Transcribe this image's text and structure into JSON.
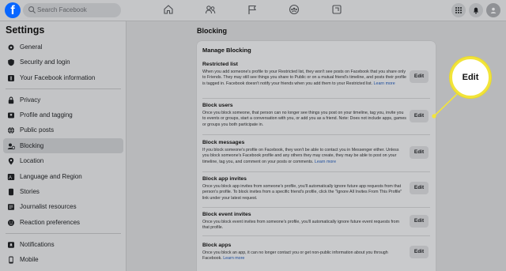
{
  "topbar": {
    "logo_letter": "f",
    "search_placeholder": "Search Facebook",
    "nav_icons": [
      "home-icon",
      "friends-icon",
      "flag-icon",
      "groups-icon",
      "gaming-icon"
    ],
    "right_icons": [
      "grid-menu-icon",
      "notifications-bell-icon",
      "account-avatar-icon"
    ]
  },
  "sidebar": {
    "title": "Settings",
    "items": [
      {
        "label": "General",
        "icon": "gear-icon"
      },
      {
        "label": "Security and login",
        "icon": "shield-icon"
      },
      {
        "label": "Your Facebook information",
        "icon": "facebook-info-icon"
      },
      {
        "label": "Privacy",
        "icon": "lock-icon"
      },
      {
        "label": "Profile and tagging",
        "icon": "tag-icon"
      },
      {
        "label": "Public posts",
        "icon": "globe-icon"
      },
      {
        "label": "Blocking",
        "icon": "blocking-icon"
      },
      {
        "label": "Location",
        "icon": "location-pin-icon"
      },
      {
        "label": "Language and Region",
        "icon": "language-icon"
      },
      {
        "label": "Stories",
        "icon": "stories-icon"
      },
      {
        "label": "Journalist resources",
        "icon": "journalist-icon"
      },
      {
        "label": "Reaction preferences",
        "icon": "reaction-icon"
      },
      {
        "label": "Notifications",
        "icon": "bell-icon"
      },
      {
        "label": "Mobile",
        "icon": "mobile-icon"
      }
    ],
    "active_item": "Blocking"
  },
  "main": {
    "title": "Blocking",
    "panel_title": "Manage Blocking",
    "sections": [
      {
        "title": "Restricted list",
        "description": "When you add someone's profile to your Restricted list, they won't see posts on Facebook that you share only to Friends. They may still see things you share to Public or on a mutual friend's timeline, and posts their profile is tagged in. Facebook doesn't notify your friends when you add them to your Restricted list.",
        "link": "Learn more",
        "button": "Edit"
      },
      {
        "title": "Block users",
        "description": "Once you block someone, that person can no longer see things you post on your timeline, tag you, invite you to events or groups, start a conversation with you, or add you as a friend. Note: Does not include apps, games or groups you both participate in.",
        "link": "",
        "button": "Edit"
      },
      {
        "title": "Block messages",
        "description": "If you block someone's profile on Facebook, they won't be able to contact you in Messenger either. Unless you block someone's Facebook profile and any others they may create, they may be able to post on your timeline, tag you, and comment on your posts or comments.",
        "link": "Learn more",
        "button": "Edit"
      },
      {
        "title": "Block app invites",
        "description": "Once you block app invites from someone's profile, you'll automatically ignore future app requests from that person's profile. To block invites from a specific friend's profile, click the \"Ignore All Invites From This Profile\" link under your latest request.",
        "link": "",
        "button": "Edit"
      },
      {
        "title": "Block event invites",
        "description": "Once you block event invites from someone's profile, you'll automatically ignore future event requests from that profile.",
        "link": "",
        "button": "Edit"
      },
      {
        "title": "Block apps",
        "description": "Once you block an app, it can no longer contact you or get non-public information about you through Facebook.",
        "link": "Learn more",
        "button": "Edit"
      }
    ]
  },
  "callout": {
    "label": "Edit",
    "color": "#f2e43a"
  },
  "colors": {
    "brand": "#0866ff",
    "link": "#1b4b9a"
  }
}
